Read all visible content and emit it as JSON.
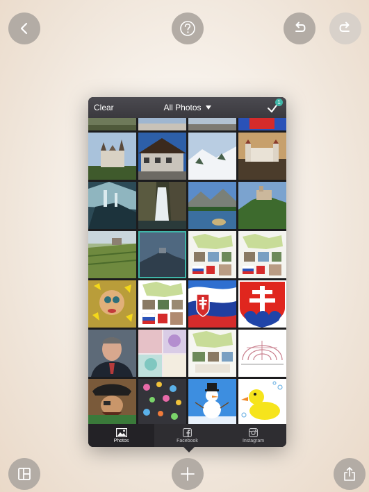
{
  "picker": {
    "clear_label": "Clear",
    "album_label": "All Photos",
    "selected_count": "1",
    "tabs": [
      {
        "label": "Photos",
        "icon": "photos-icon",
        "active": true
      },
      {
        "label": "Facebook",
        "icon": "facebook-icon",
        "active": false
      },
      {
        "label": "Instagram",
        "icon": "instagram-icon",
        "active": false
      }
    ]
  },
  "toolbar": {
    "top": [
      "back-icon",
      "help-icon",
      "undo-icon",
      "redo-icon"
    ],
    "bottom": [
      "layout-icon",
      "add-icon",
      "share-icon"
    ]
  },
  "colors": {
    "accent": "#3fb6a8",
    "button": "#b3aca5",
    "panel": "#1c1c1e"
  }
}
